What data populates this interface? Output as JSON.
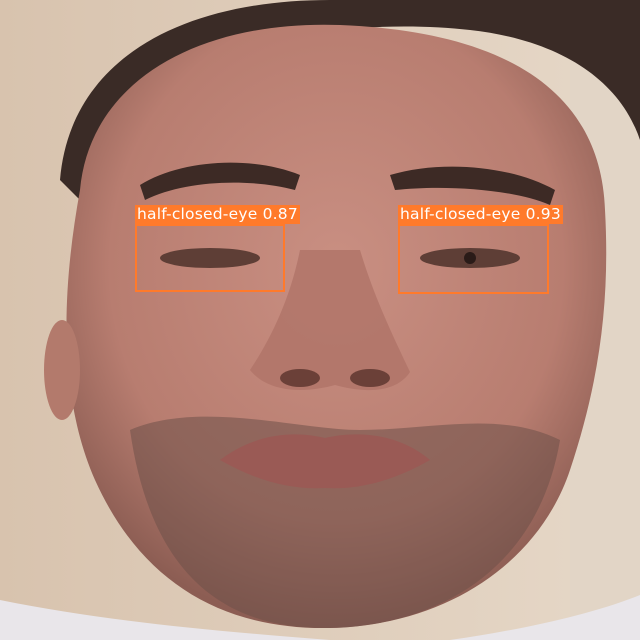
{
  "detections": [
    {
      "label": "half-closed-eye",
      "confidence": "0.87",
      "color": "#ff7a2b"
    },
    {
      "label": "half-closed-eye",
      "confidence": "0.93",
      "color": "#ff7a2b"
    }
  ]
}
